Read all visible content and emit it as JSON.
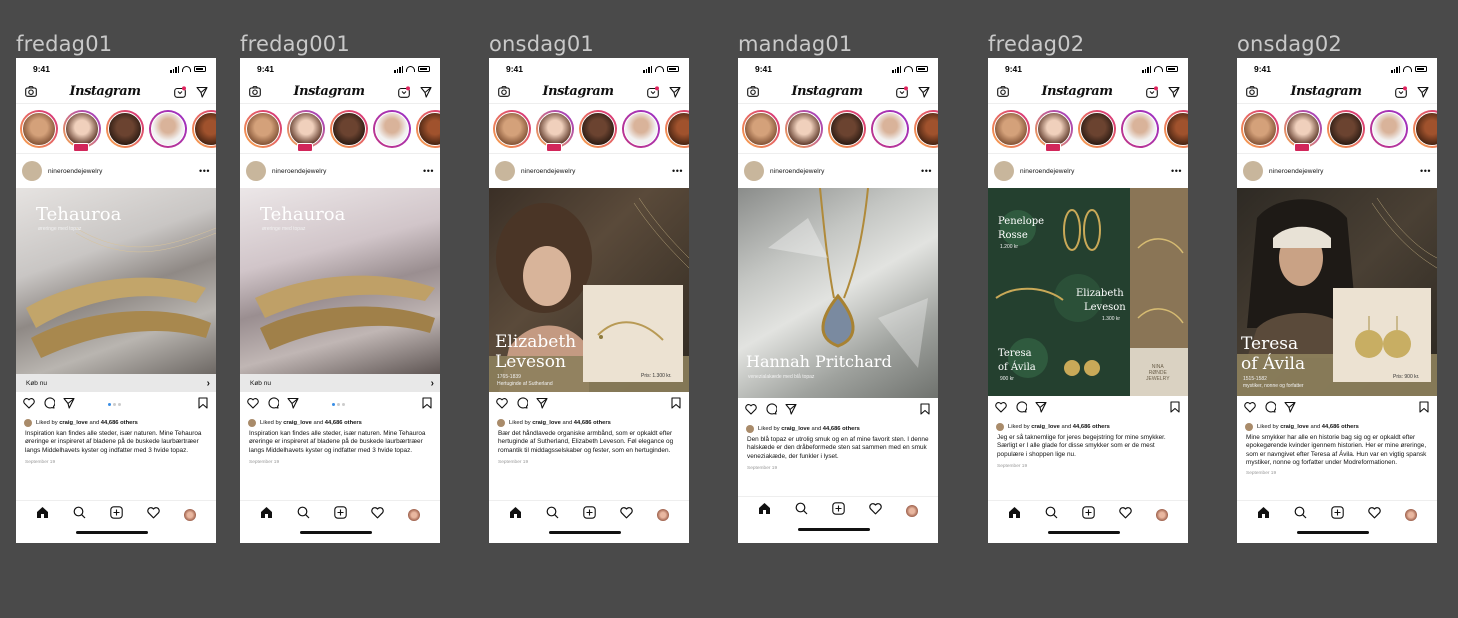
{
  "status_time": "9:41",
  "brand": "Instagram",
  "account": "nineroendejewelry",
  "likes_prefix": "Liked by ",
  "likes_user": "craig_love",
  "likes_suffix": " and ",
  "likes_count": "44,686 others",
  "date": "September 19",
  "colors": {
    "canvas": "#4a4a4a",
    "story_ring": "#c13584",
    "live_badge": "#d2265a",
    "dot_active": "#3a8ee6"
  },
  "icons": {
    "camera": "camera-icon",
    "igtv": "igtv-icon",
    "dm": "send-icon",
    "like": "heart-icon",
    "comment": "comment-icon",
    "share": "send-icon",
    "save": "bookmark-icon",
    "home": "home-icon",
    "search": "search-icon",
    "add": "add-post-icon",
    "activity": "heart-icon",
    "profile": "profile-avatar"
  },
  "frames": [
    {
      "label": "fredag01",
      "title": "Tehauroa",
      "subtitle": "øreringe med topaz",
      "shop_label": "Køb nu",
      "caption": "Inspiration kan findes alle steder, især naturen. Mine Tehauroa øreringe er inspireret af bladene på de buskede laurbærtræer langs Middelhavets kyster og indfatter med 3 hvide topaz."
    },
    {
      "label": "fredag001",
      "title": "Tehauroa",
      "subtitle": "øreringe med topaz",
      "shop_label": "Køb nu",
      "caption": "Inspiration kan findes alle steder, især naturen. Mine Tehauroa øreringe er inspireret af bladene på de buskede laurbærtræer langs Middelhavets kyster og indfatter med 3 hvide topaz."
    },
    {
      "label": "onsdag01",
      "title_line1": "Elizabeth",
      "title_line2": "Leveson",
      "subtitle_line1": "1765-1839",
      "subtitle_line2": "Hertuginde af Sutherland",
      "price": "Pris: 1.300 kr.",
      "caption": "Bær det håndlavede organiske armbånd, som er opkaldt efter hertuginde af Sutherland, Elizabeth Leveson. Føl elegance og romantik til middagsselskaber og fester, som en hertuginden."
    },
    {
      "label": "mandag01",
      "title": "Hannah Pritchard",
      "subtitle": "venezialakæde med blå topaz",
      "caption": "Den blå topaz er utrolig smuk og en af mine favorit sten. I denne halskæde er den dråbeformede sten sat sammen med en smuk veneziakæde, der funkler i lyset."
    },
    {
      "label": "fredag02",
      "penelope_line1": "Penelope",
      "penelope_line2": "Rosse",
      "penelope_price": "1.200 kr",
      "elizabeth_line1": "Elizabeth",
      "elizabeth_line2": "Leveson",
      "elizabeth_price": "1.300 kr",
      "teresa_line1": "Teresa",
      "teresa_line2": "of Ávila",
      "teresa_price": "900 kr",
      "logo_line1": "NINA",
      "logo_line2": "RØNDE",
      "logo_line3": "JEWELRY",
      "caption": "Jeg er så taknemlige for jeres begejstring for mine smykker. Særligt er I alle glade for disse smykker som er de mest populære i shoppen lige nu."
    },
    {
      "label": "onsdag02",
      "title_line1": "Teresa",
      "title_line2": "of Ávila",
      "subtitle_line1": "1515-1582",
      "subtitle_line2": "mystiker, nonne og forfatter",
      "price": "Pris: 900 kr.",
      "caption": "Mine smykker har alle en historie bag sig og er opkaldt efter epokegørende kvinder igennem historien. Her er mine øreringe, som er navngivet efter Teresa af Ávila. Hun var en vigtig spansk mystiker, nonne og forfatter under Modreformationen."
    }
  ]
}
